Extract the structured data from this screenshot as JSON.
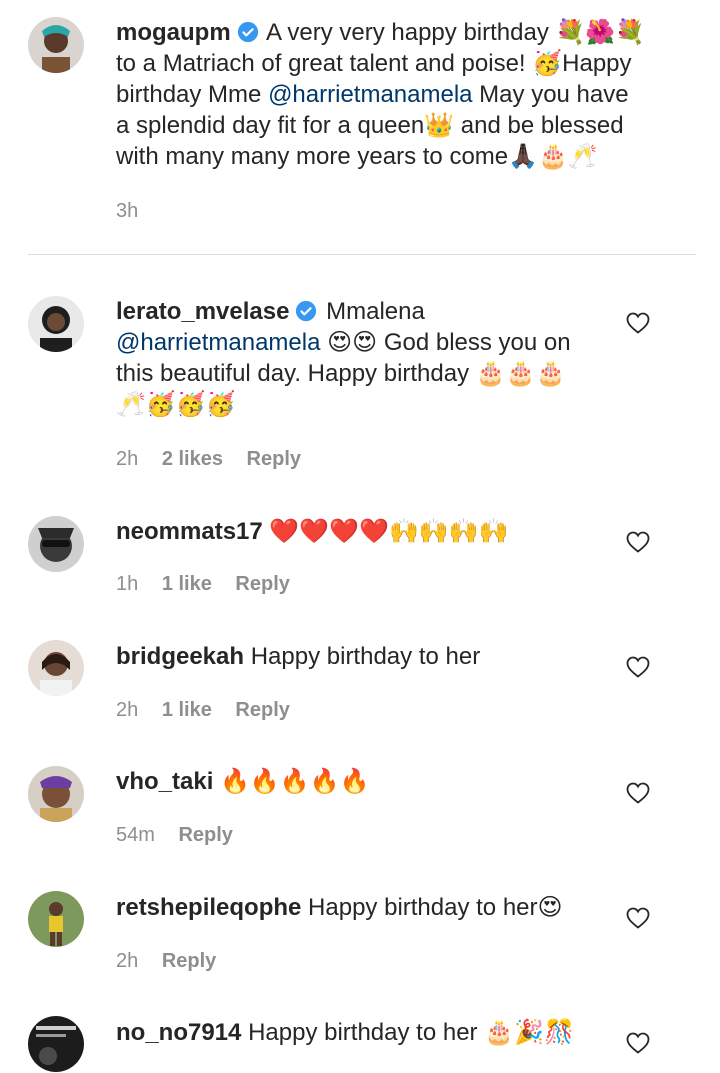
{
  "comments": [
    {
      "username": "mogaupm",
      "verified": true,
      "text_lines": [
        "A very very happy birthday 💐🌺💐",
        "to a Matriach of great talent and poise! 🥳Happy",
        "birthday Mme ",
        "a splendid day fit for a queen👑 and be blessed",
        "with many many more years to come🙏🏿🎂🥂"
      ],
      "mention": "@harrietmanamela",
      "after_mention": " May you have",
      "time": "3h"
    },
    {
      "username": "lerato_mvelase",
      "verified": true,
      "text_start": "Mmalena",
      "mention": "@harrietmanamela",
      "text_rest": " 😍😍 God bless you on",
      "line3": "this beautiful day. Happy birthday 🎂🎂🎂",
      "line4": "🥂🥳🥳🥳",
      "time": "2h",
      "likes": "2 likes",
      "reply": "Reply"
    },
    {
      "username": "neommats17",
      "text": "❤️❤️❤️❤️🙌🙌🙌🙌",
      "time": "1h",
      "likes": "1 like",
      "reply": "Reply"
    },
    {
      "username": "bridgeekah",
      "text": "Happy birthday to her",
      "time": "2h",
      "likes": "1 like",
      "reply": "Reply"
    },
    {
      "username": "vho_taki",
      "text": "🔥🔥🔥🔥🔥",
      "time": "54m",
      "reply": "Reply"
    },
    {
      "username": "retshepileqophe",
      "text": "Happy birthday to her😍",
      "time": "2h",
      "reply": "Reply"
    },
    {
      "username": "no_no7914",
      "text": "Happy birthday to her 🎂🎉🎊",
      "time": "",
      "reply": ""
    }
  ],
  "colors": {
    "text": "#262626",
    "meta": "#8e8e8e",
    "mention": "#00376b",
    "verified": "#3897f0",
    "divider": "#dbdbdb"
  },
  "icons": {
    "verified": "verified-badge-icon",
    "like": "heart-outline-icon"
  }
}
